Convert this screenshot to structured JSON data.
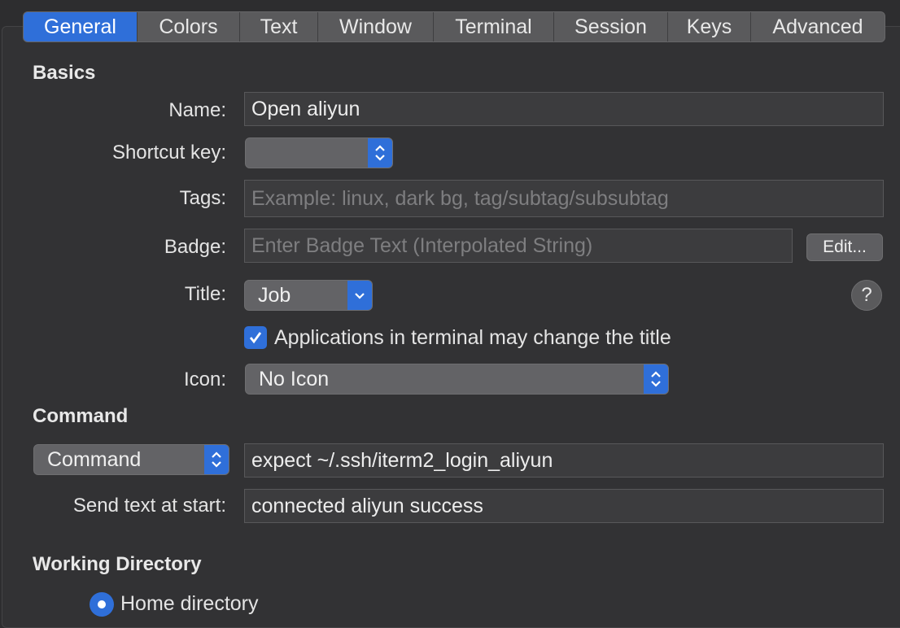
{
  "tabs": [
    {
      "label": "General",
      "active": true
    },
    {
      "label": "Colors"
    },
    {
      "label": "Text"
    },
    {
      "label": "Window"
    },
    {
      "label": "Terminal"
    },
    {
      "label": "Session"
    },
    {
      "label": "Keys"
    },
    {
      "label": "Advanced"
    }
  ],
  "basics": {
    "section_title": "Basics",
    "name_label": "Name:",
    "name_value": "Open aliyun",
    "shortcut_label": "Shortcut key:",
    "shortcut_value": "",
    "tags_label": "Tags:",
    "tags_placeholder": "Example: linux, dark bg, tag/subtag/subsubtag",
    "badge_label": "Badge:",
    "badge_placeholder": "Enter Badge Text (Interpolated String)",
    "badge_edit_button": "Edit...",
    "title_label": "Title:",
    "title_value": "Job",
    "help_button": "?",
    "apps_change_title_checkbox": "Applications in terminal may change the title",
    "apps_change_title_checked": true,
    "icon_label": "Icon:",
    "icon_value": "No Icon"
  },
  "command": {
    "section_title": "Command",
    "type_value": "Command",
    "command_value": "expect ~/.ssh/iterm2_login_aliyun",
    "send_text_label": "Send text at start:",
    "send_text_value": "connected aliyun success"
  },
  "working_directory": {
    "section_title": "Working Directory",
    "home_directory_option": "Home directory"
  },
  "colors": {
    "accent": "#2f6fd9",
    "background": "#323234",
    "field": "#3c3c3e"
  }
}
